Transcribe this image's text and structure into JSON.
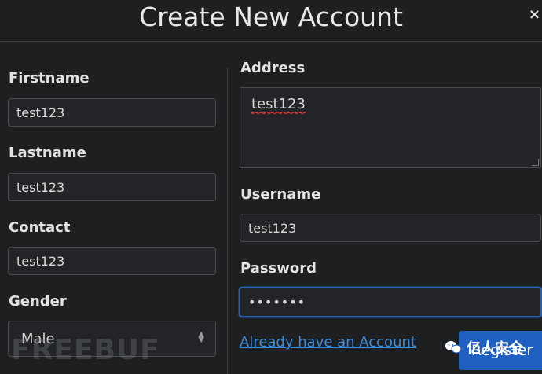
{
  "window": {
    "title": "Create New Account",
    "close_glyph": "×"
  },
  "form": {
    "firstname": {
      "label": "Firstname",
      "value": "test123"
    },
    "lastname": {
      "label": "Lastname",
      "value": "test123"
    },
    "contact": {
      "label": "Contact",
      "value": "test123"
    },
    "gender": {
      "label": "Gender",
      "value": "Male"
    },
    "address": {
      "label": "Address",
      "value": "test123"
    },
    "username": {
      "label": "Username",
      "value": "test123"
    },
    "password": {
      "label": "Password",
      "value": "•••••••"
    }
  },
  "actions": {
    "login_link": "Already have an Account",
    "register_button": "Register"
  },
  "watermarks": {
    "left": "FREEBUF",
    "right": "亿人安全"
  },
  "colors": {
    "background": "#1e1f21",
    "accent": "#1f5fbf",
    "link": "#3d8bd9",
    "focus_border": "#2d5fa8"
  },
  "icons": {
    "close": "close-icon",
    "select": "chevron-updown-icon",
    "wechat": "wechat-icon"
  }
}
